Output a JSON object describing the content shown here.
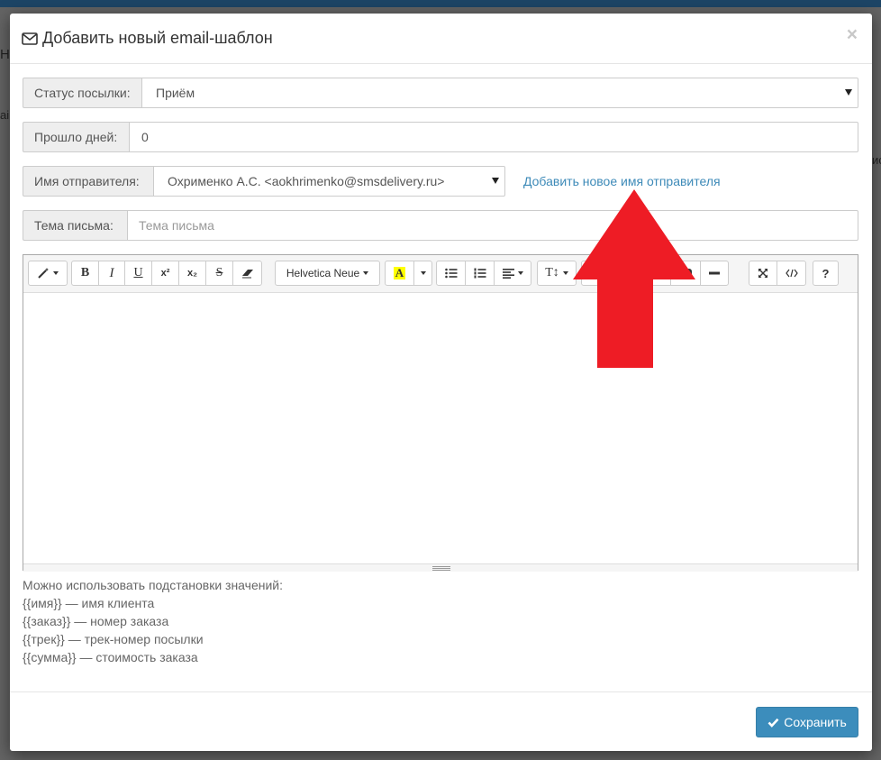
{
  "background": {
    "frag_left_top": "НІ",
    "frag_left_mid": "аі",
    "frag_right": "ис"
  },
  "modal": {
    "title": "Добавить новый email-шаблон",
    "close_label": "×",
    "status": {
      "label": "Статус посылки:",
      "value": "Приём"
    },
    "days": {
      "label": "Прошло дней:",
      "value": "0"
    },
    "sender": {
      "label": "Имя отправителя:",
      "value": "Охрименко А.С. <aokhrimenko@smsdelivery.ru>",
      "add_link": "Добавить новое имя отправителя"
    },
    "subject": {
      "label": "Тема письма:",
      "placeholder": "Тема письма"
    },
    "toolbar": {
      "bold": "B",
      "italic": "I",
      "underline": "U",
      "superscript": "x²",
      "subscript": "x₂",
      "strike": "S",
      "font": "Helvetica Neue",
      "color_letter": "A",
      "height": "T↕",
      "help": "?"
    },
    "hints": [
      "Можно использовать подстановки значений:",
      "{{имя}} — имя клиента",
      "{{заказ}} — номер заказа",
      "{{трек}} — трек-номер посылки",
      "{{сумма}} — стоимость заказа"
    ],
    "save_label": "Сохранить"
  },
  "colors": {
    "primary": "#3c8dbc",
    "link": "#3d8ab8",
    "arrow": "#ee1c25",
    "highlight": "#ffff00"
  }
}
